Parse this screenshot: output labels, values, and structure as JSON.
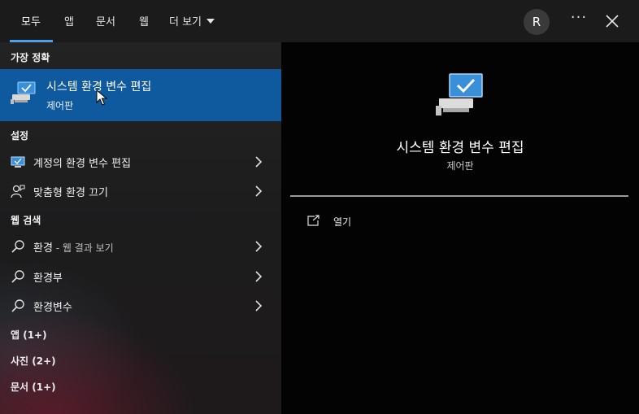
{
  "tabs": [
    {
      "label": "모두"
    },
    {
      "label": "앱"
    },
    {
      "label": "문서"
    },
    {
      "label": "웹"
    },
    {
      "label": "더 보기"
    }
  ],
  "header": {
    "avatar_initial": "R",
    "more_label": "···"
  },
  "best_match": {
    "header": "가장 정확",
    "title": "시스템 환경 변수 편집",
    "subtitle": "제어판"
  },
  "settings": {
    "header": "설정",
    "items": [
      {
        "label": "계정의 환경 변수 편집"
      },
      {
        "label": "맞춤형 환경 끄기"
      }
    ]
  },
  "web": {
    "header": "웹 검색",
    "items": [
      {
        "label": "환경",
        "suffix": " - 웹 결과 보기"
      },
      {
        "label": "환경부"
      },
      {
        "label": "환경변수"
      }
    ]
  },
  "categories": [
    "앱 (1+)",
    "사진 (2+)",
    "문서 (1+)"
  ],
  "preview": {
    "title": "시스템 환경 변수 편집",
    "subtitle": "제어판",
    "open_label": "열기"
  },
  "colors": {
    "accent": "#0f5a9e",
    "tab_underline": "#4ea0ec"
  }
}
